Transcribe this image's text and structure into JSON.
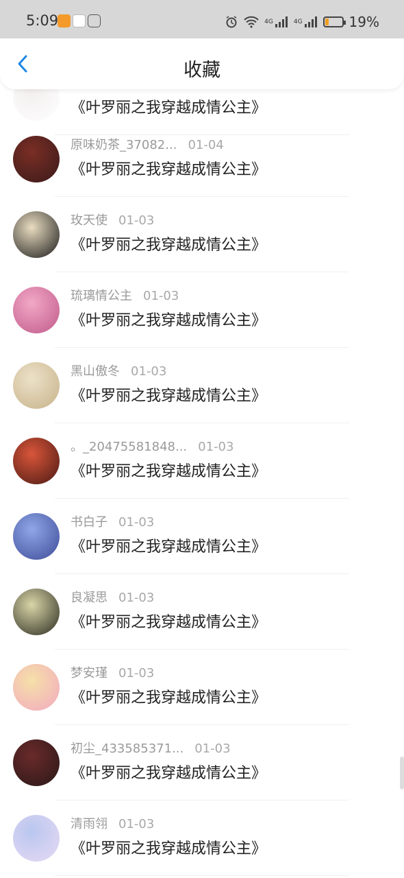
{
  "status": {
    "time": "5:09",
    "battery": "19%",
    "battery_level": 0.19,
    "net_1": "4G",
    "net_2": "4G"
  },
  "header": {
    "title": "收藏",
    "back_icon": "chevron-left-icon",
    "accent": "#1e88e5"
  },
  "favorites": [
    {
      "user": "",
      "date": "",
      "book": "《叶罗丽之我穿越成情公主》",
      "avatar_colors": [
        "#f2eeee",
        "#ffffff"
      ]
    },
    {
      "user": "原味奶茶_37082...",
      "date": "01-04",
      "book": "《叶罗丽之我穿越成情公主》",
      "avatar_colors": [
        "#7a2e25",
        "#3a1a1a"
      ]
    },
    {
      "user": "玫天使",
      "date": "01-03",
      "book": "《叶罗丽之我穿越成情公主》",
      "avatar_colors": [
        "#e9dcc0",
        "#1b1b1b"
      ]
    },
    {
      "user": "琉璃情公主",
      "date": "01-03",
      "book": "《叶罗丽之我穿越成情公主》",
      "avatar_colors": [
        "#f2a8c6",
        "#c05a8a"
      ]
    },
    {
      "user": "黑山傲冬",
      "date": "01-03",
      "book": "《叶罗丽之我穿越成情公主》",
      "avatar_colors": [
        "#ece1c8",
        "#c7b28a"
      ]
    },
    {
      "user": "。_20475581848...",
      "date": "01-03",
      "book": "《叶罗丽之我穿越成情公主》",
      "avatar_colors": [
        "#d9553a",
        "#4a1a14"
      ]
    },
    {
      "user": "书白子",
      "date": "01-03",
      "book": "《叶罗丽之我穿越成情公主》",
      "avatar_colors": [
        "#8fa6e6",
        "#3e4c99"
      ]
    },
    {
      "user": "良凝思",
      "date": "01-03",
      "book": "《叶罗丽之我穿越成情公主》",
      "avatar_colors": [
        "#d9d6a8",
        "#2b2b20"
      ]
    },
    {
      "user": "梦安瑾",
      "date": "01-03",
      "book": "《叶罗丽之我穿越成情公主》",
      "avatar_colors": [
        "#f6e0a8",
        "#f2a9c0"
      ]
    },
    {
      "user": "初尘_433585371...",
      "date": "01-03",
      "book": "《叶罗丽之我穿越成情公主》",
      "avatar_colors": [
        "#6a2a2a",
        "#2a1818"
      ]
    },
    {
      "user": "清雨翎",
      "date": "01-03",
      "book": "《叶罗丽之我穿越成情公主》",
      "avatar_colors": [
        "#b9c7ef",
        "#e7d9f4"
      ]
    }
  ]
}
